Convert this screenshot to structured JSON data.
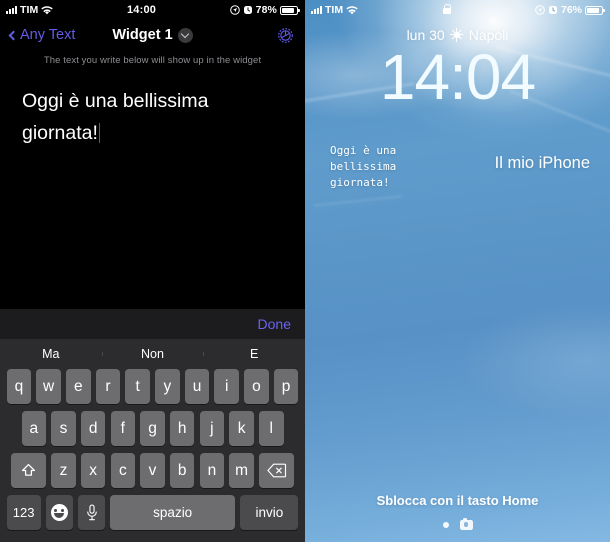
{
  "left_panel": {
    "status_bar": {
      "carrier": "TIM",
      "signal_icon": "cellular-bars-icon",
      "wifi_icon": "wifi-icon",
      "time": "14:00",
      "location_icon": "location-arrow-icon",
      "alarm_icon": "alarm-clock-icon",
      "battery_percent": "78%",
      "battery_icon": "battery-icon"
    },
    "nav": {
      "back_label": "Any Text",
      "back_icon": "chevron-left-icon",
      "title": "Widget 1",
      "title_chevron_icon": "chevron-down-icon",
      "settings_icon": "gear-icon",
      "accent_color": "#635ce6"
    },
    "hint": "The text you write below will show up in the widget",
    "editor": {
      "text": "Oggi è una bellissima giornata!",
      "caret_color": "#4b4bf5"
    },
    "toolbar": {
      "done_label": "Done"
    },
    "keyboard": {
      "suggestions": [
        "Ma",
        "Non",
        "E"
      ],
      "row1": [
        "q",
        "w",
        "e",
        "r",
        "t",
        "y",
        "u",
        "i",
        "o",
        "p"
      ],
      "row2": [
        "a",
        "s",
        "d",
        "f",
        "g",
        "h",
        "j",
        "k",
        "l"
      ],
      "row3": [
        "z",
        "x",
        "c",
        "v",
        "b",
        "n",
        "m"
      ],
      "shift_icon": "shift-arrow-icon",
      "backspace_icon": "backspace-icon",
      "numbers_label": "123",
      "emoji_icon": "emoji-smiley-icon",
      "mic_icon": "microphone-icon",
      "space_label": "spazio",
      "return_label": "invio"
    }
  },
  "right_panel": {
    "status_bar": {
      "carrier": "TIM",
      "signal_icon": "cellular-bars-icon",
      "wifi_icon": "wifi-icon",
      "lock_icon": "lock-icon",
      "location_icon": "location-arrow-icon",
      "alarm_icon": "alarm-clock-icon",
      "battery_percent": "76%",
      "battery_icon": "battery-icon"
    },
    "date_line": {
      "date": "lun 30",
      "weather_icon": "sun-icon",
      "city": "Napoli"
    },
    "clock": "14:04",
    "widget": {
      "line1": "Oggi è una",
      "line2": "bellissima",
      "line3": "giornata!"
    },
    "device_name": "Il mio iPhone",
    "unlock_hint": "Sblocca con il tasto Home",
    "bottom": {
      "page_dot_icon": "page-dot-icon",
      "camera_icon": "camera-icon"
    }
  }
}
